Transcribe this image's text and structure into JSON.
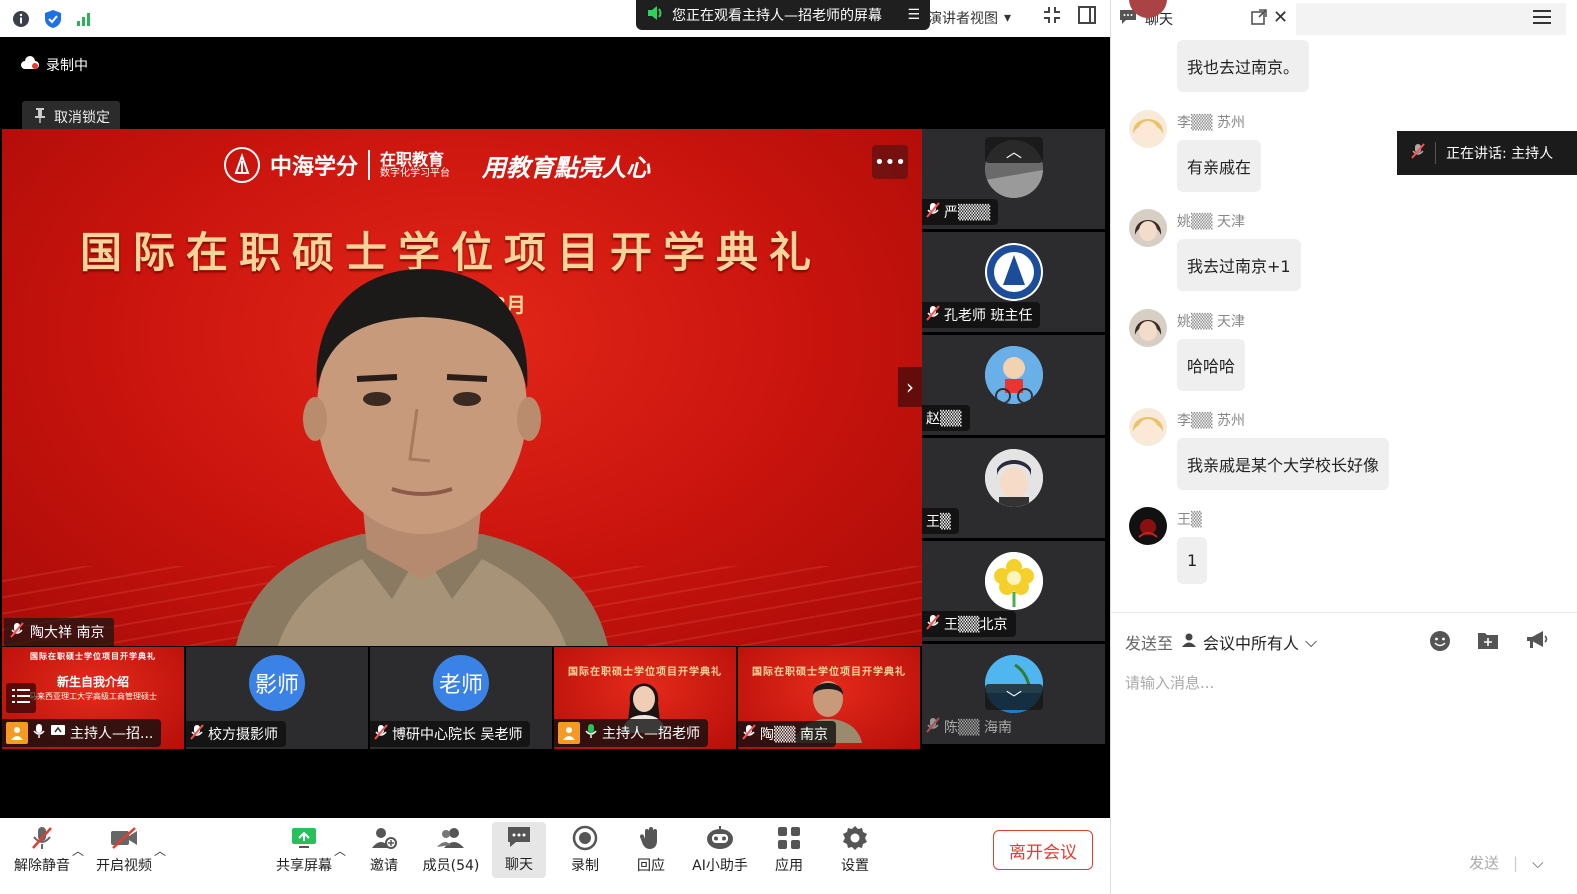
{
  "topbar": {
    "banner_text": "您正在观看主持人—招老师的屏幕",
    "view_mode": "演讲者视图"
  },
  "stage": {
    "recording_label": "录制中",
    "unpin_label": "取消锁定",
    "main_video": {
      "logo_text": "中海学分",
      "logo_sub_main": "在职教育",
      "logo_sub_small": "数字化学习平台",
      "slogan": "用教育點亮人心",
      "title": "国际在职硕士学位项目开学典礼",
      "date_fragment": "8月",
      "speaker_label": "陶大祥 南京"
    },
    "strip": [
      {
        "label": "严▒▒▒"
      },
      {
        "label": "孔老师 班主任"
      },
      {
        "label": "赵▒▒"
      },
      {
        "label": "王▒"
      },
      {
        "label": "王▒▒北京"
      },
      {
        "label": "陈▒▒ 海南"
      }
    ],
    "thumbs": [
      {
        "label": "主持人—招...",
        "slide_title": "国际在职硕士学位项目开学典礼",
        "slide_sub": "新生自我介绍",
        "slide_note": "马来西亚理工大学高级工商管理硕士"
      },
      {
        "label": "校方摄影师",
        "circle": "影师"
      },
      {
        "label": "博研中心院长 吴老师",
        "circle": "老师"
      },
      {
        "label": "主持人—招老师",
        "slide_title": "国际在职硕士学位项目开学典礼"
      },
      {
        "label": "陶▒▒ 南京",
        "slide_title": "国际在职硕士学位项目开学典礼"
      }
    ]
  },
  "toolbar": {
    "unmute": "解除静音",
    "start_video": "开启视频",
    "share": "共享屏幕",
    "invite": "邀请",
    "members": "成员(54)",
    "chat": "聊天",
    "record": "录制",
    "react": "回应",
    "ai": "AI小助手",
    "apps": "应用",
    "settings": "设置",
    "leave": "离开会议"
  },
  "chat": {
    "title": "聊天",
    "speaking": "正在讲话: 主持人",
    "messages": [
      {
        "sender": "",
        "text": "我也去过南京。"
      },
      {
        "sender": "李▒▒ 苏州",
        "text": "有亲戚在"
      },
      {
        "sender": "姚▒▒ 天津",
        "text": "我去过南京+1"
      },
      {
        "sender": "姚▒▒ 天津",
        "text": "哈哈哈"
      },
      {
        "sender": "李▒▒ 苏州",
        "text": "我亲戚是某个大学校长好像"
      },
      {
        "sender": "王▒",
        "text": "1"
      }
    ],
    "send_to_label": "发送至",
    "send_to_value": "会议中所有人",
    "input_placeholder": "请输入消息...",
    "send_label": "发送"
  },
  "colors": {
    "accent_green": "#27c15b",
    "leave_red": "#e53c2f",
    "circle_blue": "#3b82e6",
    "host_orange": "#f59a23"
  }
}
